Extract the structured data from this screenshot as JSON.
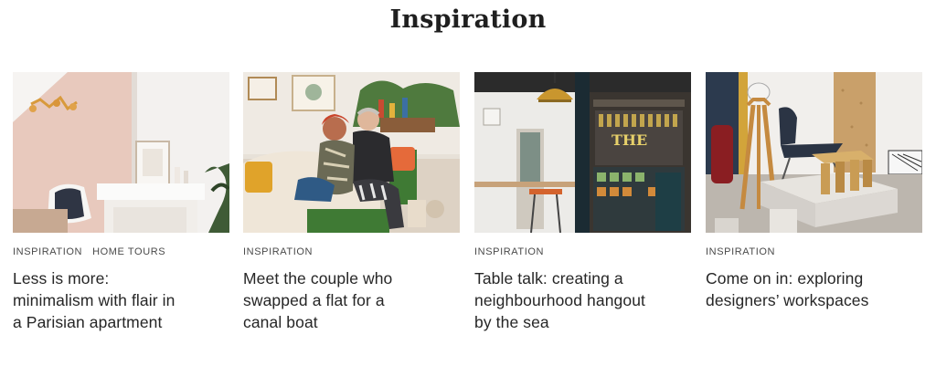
{
  "section": {
    "title": "Inspiration"
  },
  "cards": [
    {
      "tags": [
        "INSPIRATION",
        "HOME TOURS"
      ],
      "title_lines": [
        "Less is more:",
        "minimalism with flair in",
        "a Parisian apartment"
      ]
    },
    {
      "tags": [
        "INSPIRATION"
      ],
      "title_lines": [
        "Meet the couple who",
        "swapped a flat for a",
        "canal boat"
      ]
    },
    {
      "tags": [
        "INSPIRATION"
      ],
      "title_lines": [
        "Table talk: creating a",
        "neighbourhood hangout",
        "by the sea"
      ]
    },
    {
      "tags": [
        "INSPIRATION"
      ],
      "title_lines": [
        "Come on in: exploring",
        "designers’ workspaces"
      ]
    }
  ]
}
